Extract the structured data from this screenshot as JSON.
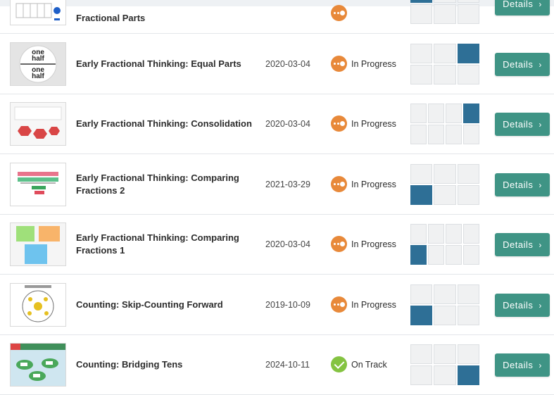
{
  "rows": [
    {
      "title": "Fractional Parts",
      "date": "",
      "status": "",
      "status_type": "progress",
      "grid_cols": 3,
      "cells": [
        1,
        0,
        0,
        0,
        0,
        0
      ],
      "button": "Details",
      "thumb": "fractional-parts-thumbnail"
    },
    {
      "title": "Early Fractional Thinking: Equal Parts",
      "date": "2020-03-04",
      "status": "In Progress",
      "status_type": "progress",
      "grid_cols": 3,
      "cells": [
        0,
        0,
        1,
        0,
        0,
        0
      ],
      "button": "Details",
      "thumb": "equal-parts-plate-thumbnail",
      "thumb_text": [
        "one",
        "half",
        "one",
        "half"
      ]
    },
    {
      "title": "Early Fractional Thinking: Consolidation",
      "date": "2020-03-04",
      "status": "In Progress",
      "status_type": "progress",
      "grid_cols": 4,
      "cells": [
        0,
        0,
        0,
        1,
        0,
        0,
        0,
        0
      ],
      "button": "Details",
      "thumb": "consolidation-hexagon-thumbnail"
    },
    {
      "title": "Early Fractional Thinking: Comparing Fractions 2",
      "date": "2021-03-29",
      "status": "In Progress",
      "status_type": "progress",
      "grid_cols": 3,
      "cells": [
        0,
        0,
        0,
        1,
        0,
        0
      ],
      "button": "Details",
      "thumb": "comparing-fractions-2-thumbnail"
    },
    {
      "title": "Early Fractional Thinking: Comparing Fractions 1",
      "date": "2020-03-04",
      "status": "In Progress",
      "status_type": "progress",
      "grid_cols": 4,
      "cells": [
        0,
        0,
        0,
        0,
        1,
        0,
        0,
        0
      ],
      "button": "Details",
      "thumb": "comparing-fractions-1-thumbnail"
    },
    {
      "title": "Counting: Skip-Counting Forward",
      "date": "2019-10-09",
      "status": "In Progress",
      "status_type": "progress",
      "grid_cols": 3,
      "cells": [
        0,
        0,
        0,
        1,
        0,
        0
      ],
      "button": "Details",
      "thumb": "skip-counting-thumbnail"
    },
    {
      "title": "Counting: Bridging Tens",
      "date": "2024-10-11",
      "status": "On Track",
      "status_type": "track",
      "grid_cols": 3,
      "cells": [
        0,
        0,
        0,
        0,
        0,
        1
      ],
      "button": "Details",
      "thumb": "bridging-tens-thumbnail"
    }
  ],
  "colors": {
    "accent": "#3f9485",
    "progress": "#e8893a",
    "on_track": "#84c341",
    "filled_cell": "#2e6f96"
  }
}
